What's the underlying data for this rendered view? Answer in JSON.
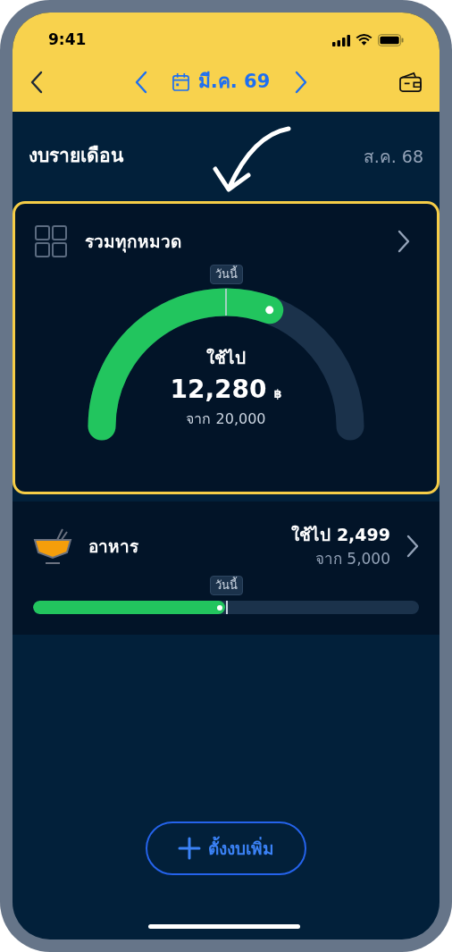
{
  "status_bar": {
    "time": "9:41"
  },
  "header": {
    "month": "มี.ค. 69"
  },
  "section": {
    "title": "งบรายเดือน",
    "period": "ส.ค. 68"
  },
  "total_budget": {
    "name": "รวมทุกหมวด",
    "today_label": "วันนี้",
    "spent_label": "ใช้ไป",
    "spent": "12,280",
    "currency": "฿",
    "budget": "จาก 20,000",
    "selected": true
  },
  "categories": [
    {
      "name": "อาหาร",
      "spent": "ใช้ไป 2,499",
      "budget": "จาก 5,000",
      "today_label": "วันนี้",
      "level": 0.497,
      "selected": false
    }
  ],
  "add_button": {
    "label": "ตั้งงบเพิ่ม"
  }
}
